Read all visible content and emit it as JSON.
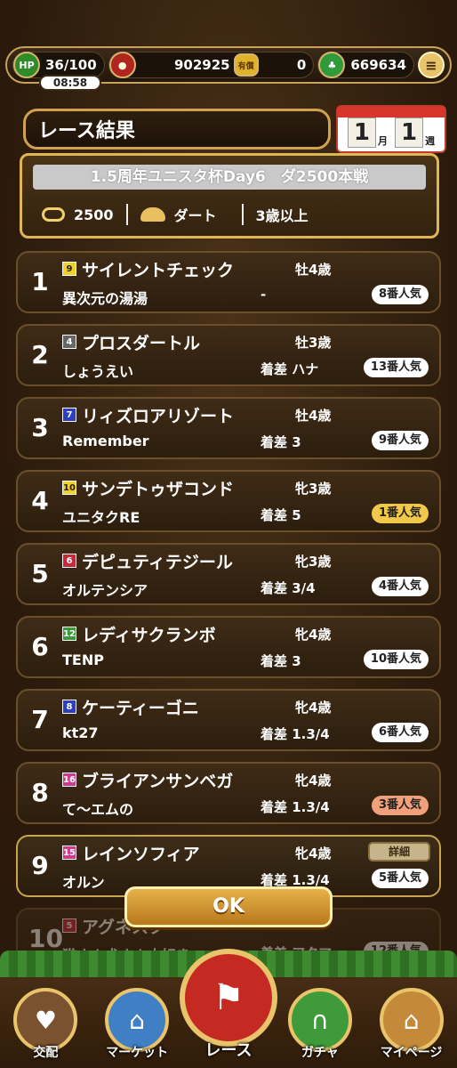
{
  "status": {
    "hp": "36/100",
    "timer": "08:58",
    "carrots": "902925",
    "ticket_label": "有償",
    "tickets": "0",
    "clovers": "669634"
  },
  "title": "レース結果",
  "calendar": {
    "month": "1",
    "month_unit": "月",
    "week": "1",
    "week_unit": "週"
  },
  "race": {
    "name": "1.5周年ユニスタ杯Day6　ダ2500本戦",
    "distance": "2500",
    "surface": "ダート",
    "condition": "3歳以上"
  },
  "results": [
    {
      "rank": "1",
      "gate": "9",
      "gate_color": "#f2d02a",
      "gate_text": "#222",
      "horse": "サイレントチェック",
      "sexage": "牡4歳",
      "owner": "異次元の湯湯",
      "margin": "-",
      "popularity": "8番人気",
      "pop_style": "white"
    },
    {
      "rank": "2",
      "gate": "4",
      "gate_color": "#666666",
      "gate_text": "#fff",
      "horse": "プロスダートル",
      "sexage": "牡3歳",
      "owner": "しょうえい",
      "margin": "着差 ハナ",
      "popularity": "13番人気",
      "pop_style": "white"
    },
    {
      "rank": "3",
      "gate": "7",
      "gate_color": "#2d3fbf",
      "gate_text": "#fff",
      "horse": "リィズロアリゾート",
      "sexage": "牡4歳",
      "owner": "Remember",
      "margin": "着差 3",
      "popularity": "9番人気",
      "pop_style": "white"
    },
    {
      "rank": "4",
      "gate": "10",
      "gate_color": "#f2d02a",
      "gate_text": "#222",
      "horse": "サンデトゥザコンド",
      "sexage": "牝3歳",
      "owner": "ユニタクRE",
      "margin": "着差 5",
      "popularity": "1番人気",
      "pop_style": "gold"
    },
    {
      "rank": "5",
      "gate": "6",
      "gate_color": "#c8283a",
      "gate_text": "#fff",
      "horse": "デピュティテジール",
      "sexage": "牝3歳",
      "owner": "オルテンシア",
      "margin": "着差 3/4",
      "popularity": "4番人気",
      "pop_style": "white"
    },
    {
      "rank": "6",
      "gate": "12",
      "gate_color": "#3a9a3a",
      "gate_text": "#fff",
      "horse": "レディサクランボ",
      "sexage": "牝4歳",
      "owner": "TENP",
      "margin": "着差 3",
      "popularity": "10番人気",
      "pop_style": "white"
    },
    {
      "rank": "7",
      "gate": "8",
      "gate_color": "#2d3fbf",
      "gate_text": "#fff",
      "horse": "ケーティーゴニ",
      "sexage": "牝4歳",
      "owner": "kt27",
      "margin": "着差 1.3/4",
      "popularity": "6番人気",
      "pop_style": "white"
    },
    {
      "rank": "8",
      "gate": "16",
      "gate_color": "#d03a8a",
      "gate_text": "#fff",
      "horse": "ブライアンサンベガ",
      "sexage": "牝4歳",
      "owner": "て～エムの",
      "margin": "着差 1.3/4",
      "popularity": "3番人気",
      "pop_style": "orange"
    },
    {
      "rank": "9",
      "gate": "15",
      "gate_color": "#d03a8a",
      "gate_text": "#fff",
      "horse": "レインソフィア",
      "sexage": "牝4歳",
      "owner": "オルン",
      "margin": "着差 1.3/4",
      "popularity": "5番人気",
      "pop_style": "white",
      "detail": "詳細"
    },
    {
      "rank": "10",
      "gate": "5",
      "gate_color": "#c8283a",
      "gate_text": "#fff",
      "horse": "アグネスク",
      "sexage": "",
      "owner": "猫さん犬さん大好き",
      "margin": "着差 アタマ",
      "popularity": "12番人気",
      "pop_style": "white"
    }
  ],
  "ok_label": "OK",
  "nav": [
    {
      "label": "交配",
      "icon": "horses-icon",
      "glyph": "♥",
      "color": "#7a5230"
    },
    {
      "label": "マーケット",
      "icon": "market-icon",
      "glyph": "⌂",
      "color": "#3f7fc4"
    },
    {
      "label": "レース",
      "icon": "checkered-flag-icon",
      "glyph": "⚑",
      "color": "#c42a22"
    },
    {
      "label": "ガチャ",
      "icon": "horseshoe-icon",
      "glyph": "∩",
      "color": "#3f9a3a"
    },
    {
      "label": "マイページ",
      "icon": "home-icon",
      "glyph": "⌂",
      "color": "#c48a3a"
    }
  ]
}
